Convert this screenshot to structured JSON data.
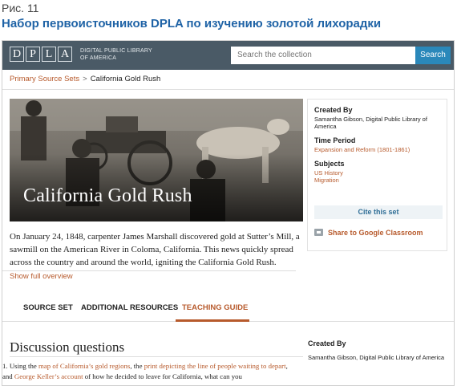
{
  "figure": {
    "label": "Рис. 11",
    "title": "Набор первоисточников DPLA по изучению золотой лихорадки"
  },
  "header": {
    "logo_letters": [
      "D",
      "P",
      "L",
      "A"
    ],
    "logo_sub": "DIGITAL PUBLIC LIBRARY\nOF AMERICA",
    "search_placeholder": "Search the collection",
    "search_button": "Search"
  },
  "breadcrumb": {
    "parent": "Primary Source Sets",
    "separator": ">",
    "current": "California Gold Rush"
  },
  "hero": {
    "title": "California Gold Rush"
  },
  "overview": {
    "text": "On January 24, 1848, carpenter James Marshall discovered gold at Sutter’s Mill, a sawmill on the American River in Coloma, California. This news quickly spread across the country and around the world, igniting the California Gold Rush.",
    "show_more": "Show full overview"
  },
  "sidebar": {
    "created_by_label": "Created By",
    "created_by_value": "Samantha Gibson, Digital Public Library of America",
    "time_period_label": "Time Period",
    "time_period_value": "Expansion and Reform (1801-1861)",
    "subjects_label": "Subjects",
    "subjects": [
      "US History",
      "Migration"
    ],
    "cite_button": "Cite this set",
    "share_link": "Share to Google Classroom"
  },
  "tabs": [
    {
      "label": "SOURCE SET",
      "active": false
    },
    {
      "label": "ADDITIONAL RESOURCES",
      "active": false
    },
    {
      "label": "TEACHING GUIDE",
      "active": true
    }
  ],
  "teaching": {
    "section_title": "Discussion questions",
    "q_number": "1.",
    "q_parts": [
      {
        "text": "Using the ",
        "link": false
      },
      {
        "text": "map of California’s gold regions",
        "link": true
      },
      {
        "text": ", the ",
        "link": false
      },
      {
        "text": "print depicting the line of people waiting to depart",
        "link": true
      },
      {
        "text": ", and ",
        "link": false
      },
      {
        "text": "George Keller’s account",
        "link": true
      },
      {
        "text": " of how he decided to leave for California, what can you",
        "link": false
      }
    ],
    "created_by_label": "Created By",
    "created_by_value": "Samantha Gibson, Digital Public Library of America"
  },
  "colors": {
    "header_bg": "#4a5a66",
    "accent": "#b75a2c",
    "search_button": "#2a88ba",
    "figure_title": "#1f63a6"
  }
}
